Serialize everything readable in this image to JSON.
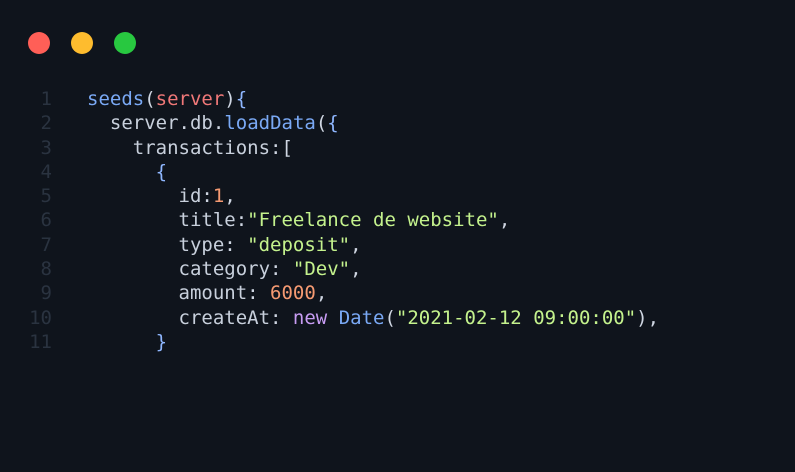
{
  "window": {
    "controls": {
      "close_color": "#ff5f57",
      "minimize_color": "#febc2e",
      "maximize_color": "#28c840"
    }
  },
  "editor": {
    "lines": [
      {
        "number": "1",
        "indent": "",
        "tokens": [
          {
            "text": "seeds",
            "kind": "fn"
          },
          {
            "text": "(",
            "kind": "punc"
          },
          {
            "text": "server",
            "kind": "param"
          },
          {
            "text": ")",
            "kind": "punc"
          },
          {
            "text": "{",
            "kind": "brace"
          }
        ]
      },
      {
        "number": "2",
        "indent": "  ",
        "tokens": [
          {
            "text": "server",
            "kind": "key"
          },
          {
            "text": ".",
            "kind": "punc"
          },
          {
            "text": "db",
            "kind": "key"
          },
          {
            "text": ".",
            "kind": "punc"
          },
          {
            "text": "loadData",
            "kind": "fn"
          },
          {
            "text": "(",
            "kind": "punc"
          },
          {
            "text": "{",
            "kind": "brace"
          }
        ]
      },
      {
        "number": "3",
        "indent": "    ",
        "tokens": [
          {
            "text": "transactions",
            "kind": "key"
          },
          {
            "text": ":[",
            "kind": "punc"
          }
        ]
      },
      {
        "number": "4",
        "indent": "      ",
        "tokens": [
          {
            "text": "{",
            "kind": "brace"
          }
        ]
      },
      {
        "number": "5",
        "indent": "        ",
        "tokens": [
          {
            "text": "id",
            "kind": "key"
          },
          {
            "text": ":",
            "kind": "punc"
          },
          {
            "text": "1",
            "kind": "num"
          },
          {
            "text": ",",
            "kind": "punc"
          }
        ]
      },
      {
        "number": "6",
        "indent": "        ",
        "tokens": [
          {
            "text": "title",
            "kind": "key"
          },
          {
            "text": ":",
            "kind": "punc"
          },
          {
            "text": "\"Freelance de website\"",
            "kind": "str"
          },
          {
            "text": ",",
            "kind": "punc"
          }
        ]
      },
      {
        "number": "7",
        "indent": "        ",
        "tokens": [
          {
            "text": "type",
            "kind": "key"
          },
          {
            "text": ": ",
            "kind": "punc"
          },
          {
            "text": "\"deposit\"",
            "kind": "str"
          },
          {
            "text": ",",
            "kind": "punc"
          }
        ]
      },
      {
        "number": "8",
        "indent": "        ",
        "tokens": [
          {
            "text": "category",
            "kind": "key"
          },
          {
            "text": ": ",
            "kind": "punc"
          },
          {
            "text": "\"Dev\"",
            "kind": "str"
          },
          {
            "text": ",",
            "kind": "punc"
          }
        ]
      },
      {
        "number": "9",
        "indent": "        ",
        "tokens": [
          {
            "text": "amount",
            "kind": "key"
          },
          {
            "text": ": ",
            "kind": "punc"
          },
          {
            "text": "6000",
            "kind": "num"
          },
          {
            "text": ",",
            "kind": "punc"
          }
        ]
      },
      {
        "number": "10",
        "indent": "        ",
        "tokens": [
          {
            "text": "createAt",
            "kind": "key"
          },
          {
            "text": ": ",
            "kind": "punc"
          },
          {
            "text": "new",
            "kind": "kw"
          },
          {
            "text": " ",
            "kind": "punc"
          },
          {
            "text": "Date",
            "kind": "fn"
          },
          {
            "text": "(",
            "kind": "punc"
          },
          {
            "text": "\"2021-02-12 09:00:00\"",
            "kind": "str"
          },
          {
            "text": "),",
            "kind": "punc"
          }
        ]
      },
      {
        "number": "11",
        "indent": "      ",
        "tokens": [
          {
            "text": "}",
            "kind": "brace"
          }
        ]
      }
    ]
  }
}
